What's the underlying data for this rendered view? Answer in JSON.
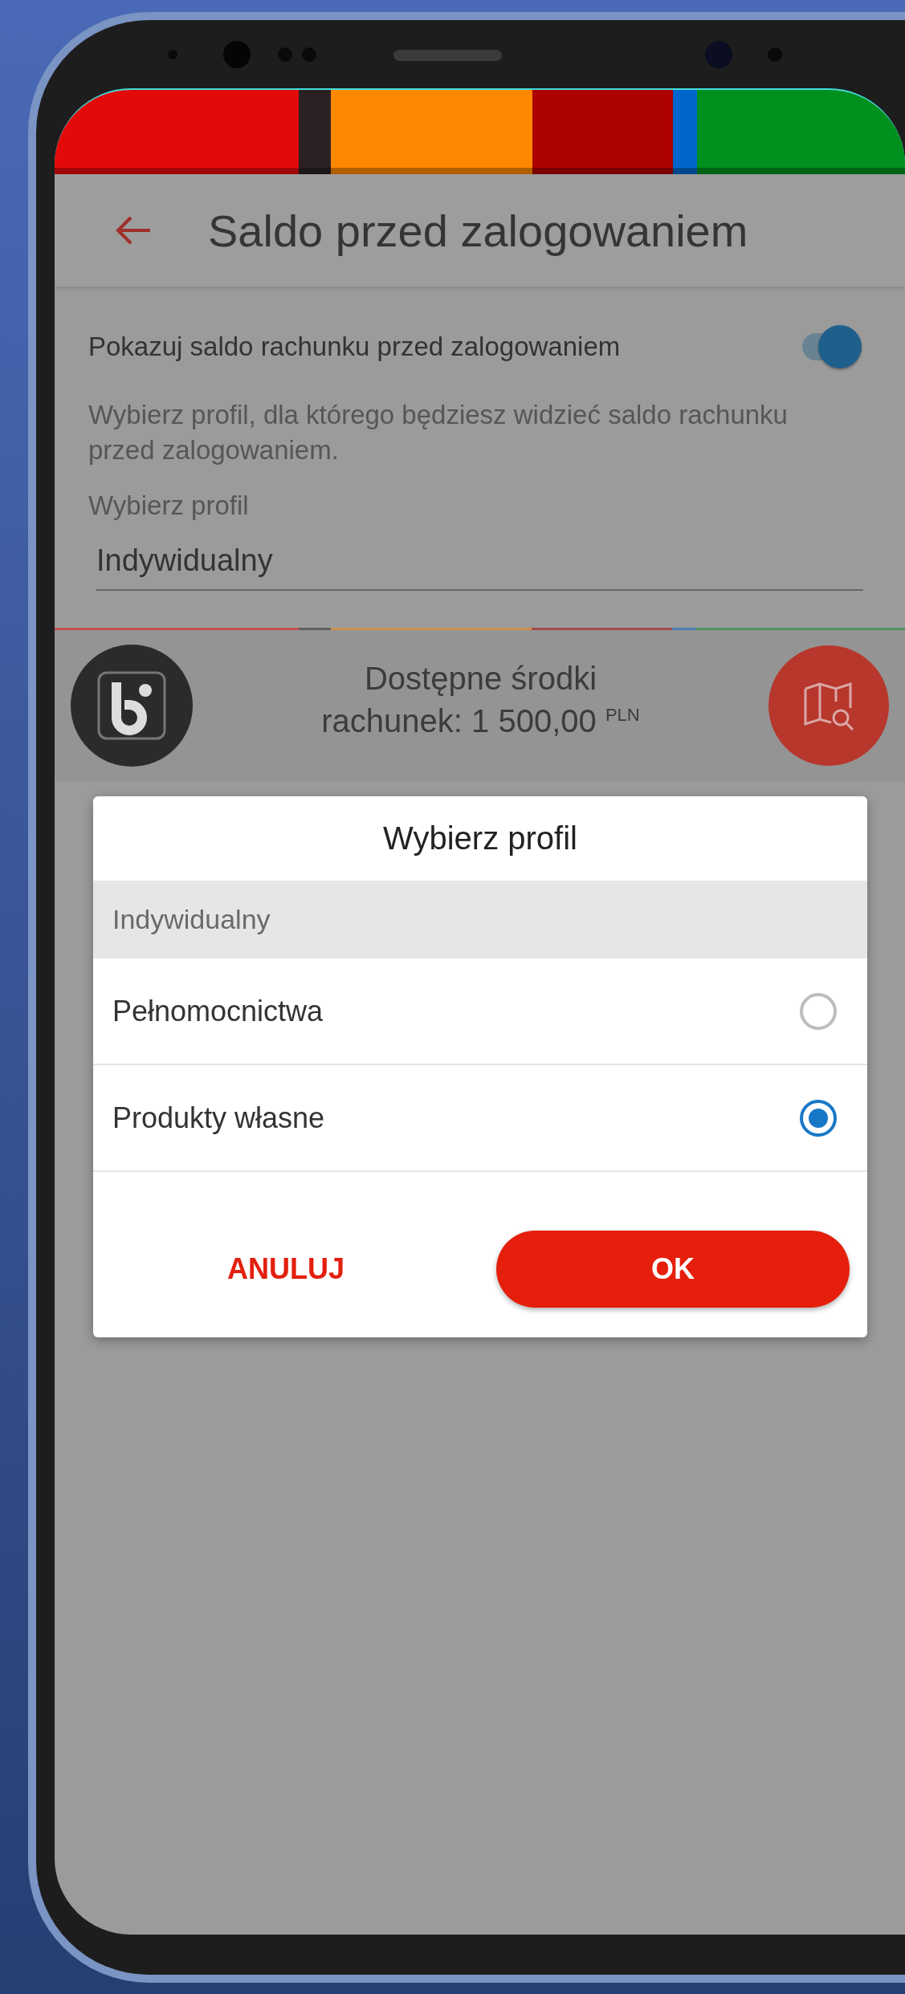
{
  "app_bar": {
    "title": "Saldo przed zalogowaniem"
  },
  "settings": {
    "toggle": {
      "label": "Pokazuj saldo rachunku przed zalogowaniem",
      "on": true
    },
    "description": "Wybierz profil, dla którego będziesz widzieć saldo rachunku przed zalogowaniem.",
    "profile_field": {
      "label": "Wybierz profil",
      "value": "Indywidualny"
    }
  },
  "balance_preview": {
    "title": "Dostępne środki",
    "amount": "rachunek: 1 500,00 $^{PLN}$"
  },
  "dialog": {
    "title": "Wybierz profil",
    "group": "Indywidualny",
    "options": [
      {
        "label": "Pełnomocnictwa",
        "selected": false
      },
      {
        "label": "Produkty własne",
        "selected": true
      }
    ],
    "buttons": [
      {
        "label": "ANULUJ",
        "kind": "text"
      },
      {
        "label": "OK",
        "kind": "primary"
      }
    ]
  }
}
